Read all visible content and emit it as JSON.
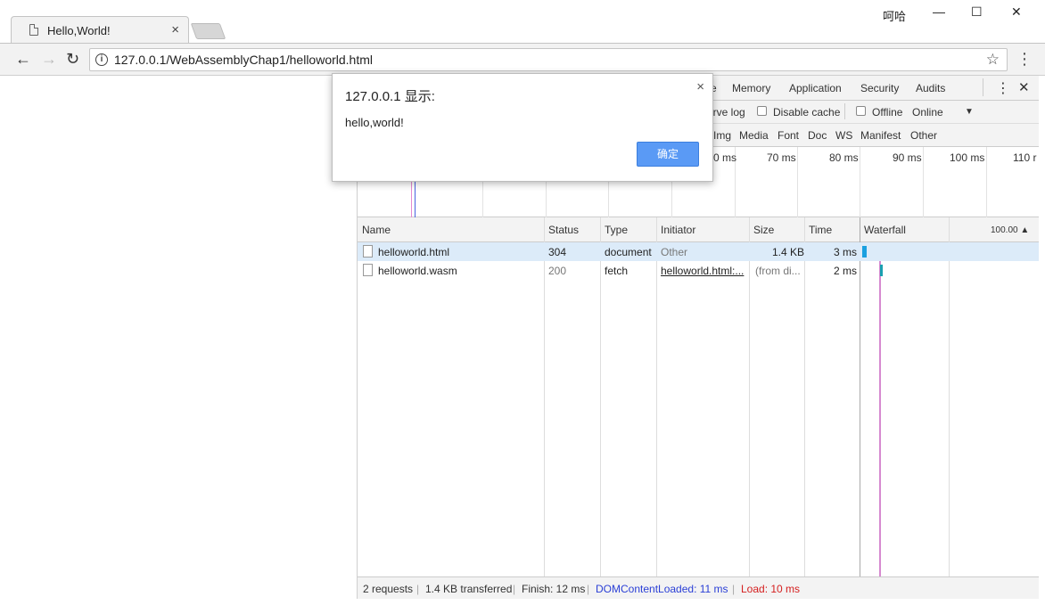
{
  "browser": {
    "tab_title": "Hello,World!",
    "tab_close": "×",
    "user_name": "呵哈",
    "minimize": "—",
    "maximize": "☐",
    "close": "✕",
    "back": "←",
    "forward": "→",
    "reload": "↻",
    "info_icon": "i",
    "url": "127.0.0.1/WebAssemblyChap1/helloworld.html",
    "star": "☆",
    "menu": "⋮"
  },
  "devtools": {
    "tabs": [
      "e",
      "Memory",
      "Application",
      "Security",
      "Audits"
    ],
    "more": "⋮",
    "close": "✕",
    "filter": {
      "preserve_log": "erve log",
      "disable_cache": "Disable cache",
      "offline": "Offline",
      "throttle": "Online",
      "throttle_arrow": "▼"
    },
    "types": [
      "Img",
      "Media",
      "Font",
      "Doc",
      "WS",
      "Manifest",
      "Other"
    ],
    "overview_labels": [
      "0 ms",
      "70 ms",
      "80 ms",
      "90 ms",
      "100 ms",
      "110 r"
    ],
    "columns": {
      "name": "Name",
      "status": "Status",
      "type": "Type",
      "initiator": "Initiator",
      "size": "Size",
      "time": "Time",
      "waterfall": "Waterfall",
      "waterfall_scale": "100.00 ▲"
    },
    "rows": [
      {
        "name": "helloworld.html",
        "status": "304",
        "type": "document",
        "initiator": "Other",
        "size": "1.4 KB",
        "time": "3 ms"
      },
      {
        "name": "helloworld.wasm",
        "status": "200",
        "type": "fetch",
        "initiator": "helloworld.html:...",
        "size": "(from di...",
        "time": "2 ms"
      }
    ],
    "statusbar": {
      "requests": "2 requests",
      "transferred": "1.4 KB transferred",
      "finish": "Finish: 12 ms",
      "dcl": "DOMContentLoaded: 11 ms",
      "load": "Load: 10 ms",
      "sep": "|"
    },
    "colors": {
      "dcl": "#2a3fd6",
      "load": "#d52020",
      "selected_row": "#dcebf9"
    }
  },
  "dialog": {
    "title": "127.0.0.1 显示:",
    "message": "hello,world!",
    "ok": "确定",
    "close": "×"
  }
}
